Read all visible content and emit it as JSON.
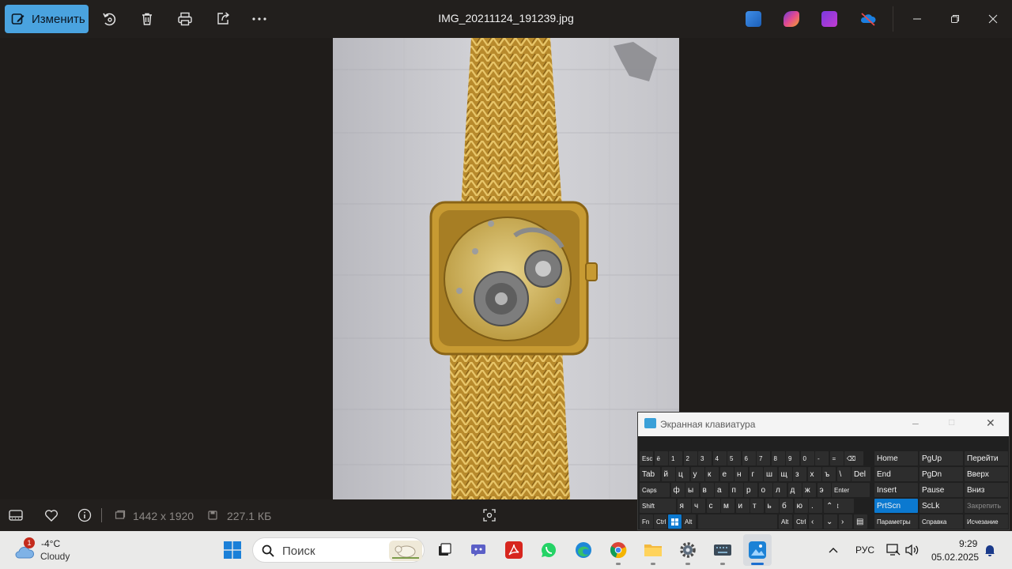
{
  "toolbar": {
    "edit_label": "Изменить",
    "file_title": "IMG_20211124_191239.jpg"
  },
  "info": {
    "dimensions": "1442 x 1920",
    "file_size": "227.1 КБ"
  },
  "osk": {
    "title": "Экранная клавиатура",
    "rows": [
      [
        "Esc",
        "ё",
        "1",
        "2",
        "3",
        "4",
        "5",
        "6",
        "7",
        "8",
        "9",
        "0",
        "-",
        "=",
        "⌫"
      ],
      [
        "Tab",
        "й",
        "ц",
        "у",
        "к",
        "е",
        "н",
        "г",
        "ш",
        "щ",
        "з",
        "х",
        "ъ",
        "\\",
        "Del"
      ],
      [
        "Caps",
        "ф",
        "ы",
        "в",
        "а",
        "п",
        "р",
        "о",
        "л",
        "д",
        "ж",
        "э",
        "Enter"
      ],
      [
        "Shift",
        "я",
        "ч",
        "с",
        "м",
        "и",
        "т",
        "ь",
        "б",
        "ю",
        ".",
        "Shift"
      ],
      [
        "Fn",
        "Ctrl",
        "Alt",
        "Alt",
        "Ctrl"
      ]
    ],
    "side_keys": [
      [
        "Home",
        "PgUp",
        "Перейти"
      ],
      [
        "End",
        "PgDn",
        "Вверх"
      ],
      [
        "Insert",
        "Pause",
        "Вниз"
      ],
      [
        "PrtScn",
        "ScLk",
        "Закрепить"
      ],
      [
        "Параметры",
        "Справка",
        "Исчезание"
      ]
    ]
  },
  "weather": {
    "badge": "1",
    "temp": "-4°C",
    "condition": "Cloudy"
  },
  "taskbar": {
    "search_placeholder": "Поиск",
    "language": "РУС",
    "time": "9:29",
    "date": "05.02.2025"
  },
  "colors": {
    "accent": "#4aa3df",
    "highlight_key": "#0b79d0",
    "background": "#1f1c1a"
  }
}
